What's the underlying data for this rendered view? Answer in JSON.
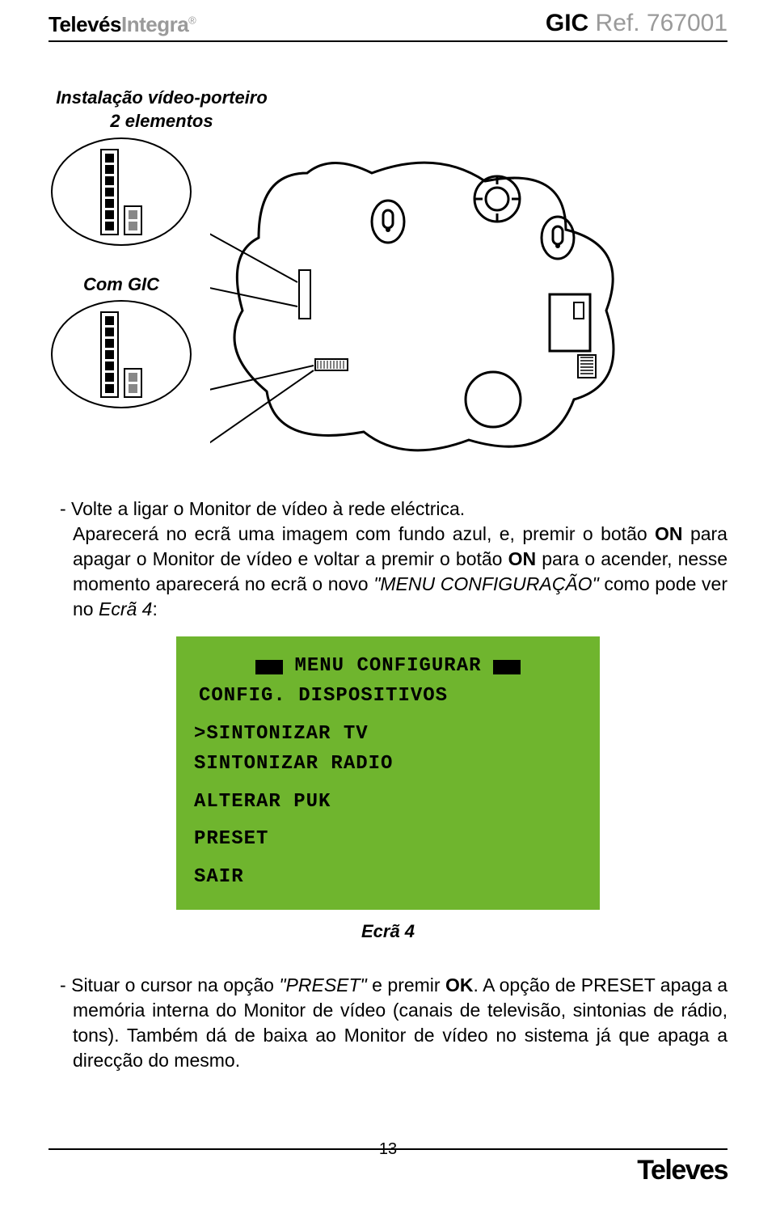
{
  "header": {
    "brand_bold": "Televés",
    "brand_grey": "Integra",
    "brand_reg": "®",
    "ref_gic": "GIC",
    "ref_rest": "  Ref. 767001"
  },
  "titles": {
    "install_title_l1": "Instalação vídeo-porteiro",
    "install_title_l2": "2 elementos",
    "com_gic": "Com GIC"
  },
  "para1_a": "- Volte a ligar o Monitor de vídeo à rede eléctrica.",
  "para1_b_pre": "Aparecerá no ecrã uma imagem com fundo azul, e, premir o botão ",
  "para1_b_on1": "ON",
  "para1_b_mid": " para apagar o Monitor de vídeo e voltar a premir o botão ",
  "para1_b_on2": "ON",
  "para1_b_mid2": " para o acender, nesse momento aparecerá no ecrã o novo ",
  "para1_b_em": "\"MENU CONFIGURAÇÃO\"",
  "para1_b_post": " como pode ver no ",
  "para1_b_ecra": "Ecrã 4",
  "para1_b_colon": ":",
  "menu": {
    "title": "MENU CONFIGURAR",
    "l2": "CONFIG. DISPOSITIVOS",
    "l3": ">SINTONIZAR TV",
    "l4": " SINTONIZAR RADIO",
    "l5": "ALTERAR PUK",
    "l6": "PRESET",
    "l7": "SAIR"
  },
  "caption": "Ecrã 4",
  "para2_pre": "- Situar o cursor na opção ",
  "para2_em1": "\"PRESET\"",
  "para2_mid1": " e premir ",
  "para2_ok": "OK",
  "para2_mid2": ". A opção de PRESET apaga a memória interna do Monitor de vídeo (canais de televisão, sintonias de rádio, tons). Também dá de baixa ao Monitor de vídeo no sistema já que apaga a direcção do mesmo.",
  "footer": {
    "pageno": "13",
    "logo": "Televes"
  }
}
